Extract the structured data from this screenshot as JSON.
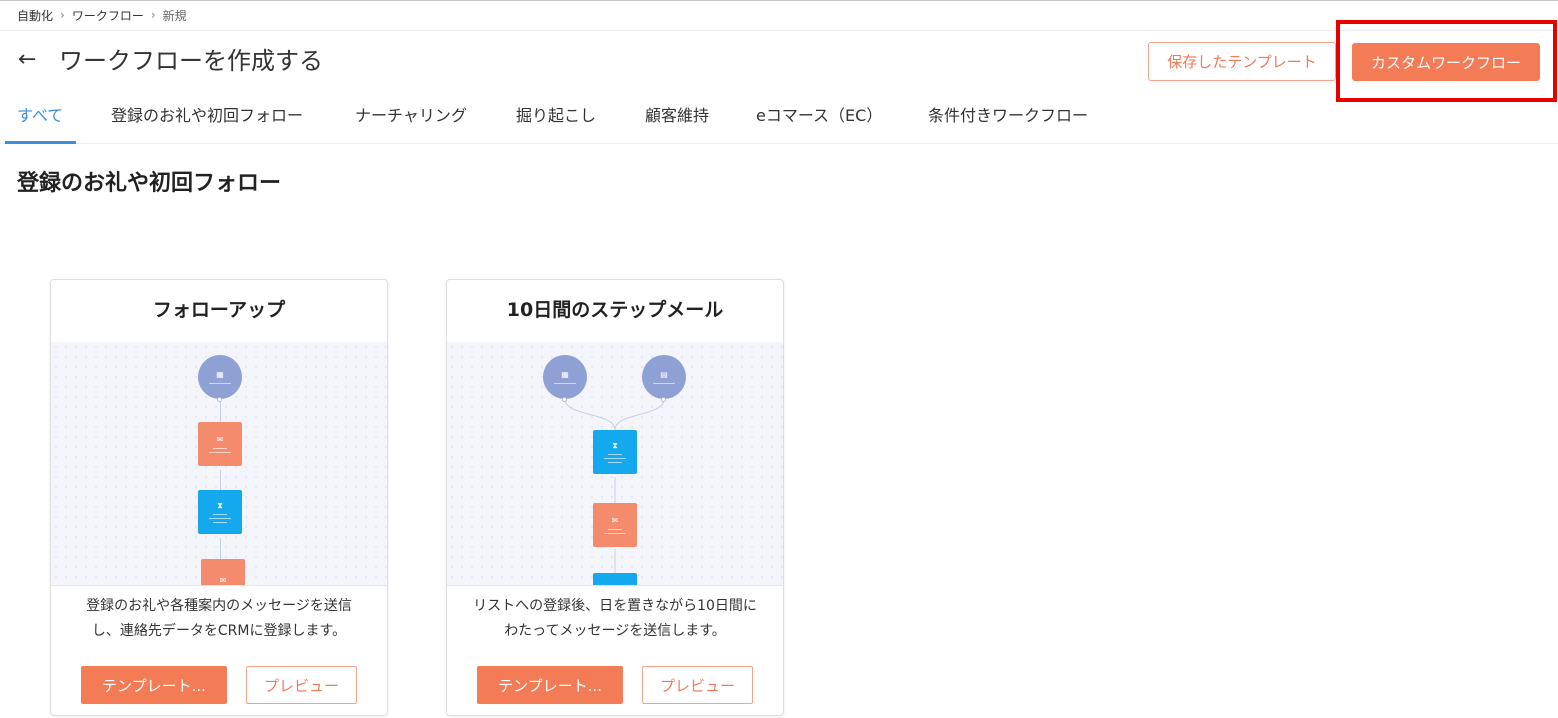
{
  "breadcrumb": {
    "items": [
      "自動化",
      "ワークフロー",
      "新規"
    ],
    "separator": "›"
  },
  "header": {
    "back_icon": "arrow-left-icon",
    "back_glyph": "←",
    "title": "ワークフローを作成する",
    "saved_templates_label": "保存したテンプレート",
    "custom_workflow_label": "カスタムワークフロー"
  },
  "tabs": [
    {
      "label": "すべて",
      "active": true
    },
    {
      "label": "登録のお礼や初回フォロー",
      "active": false
    },
    {
      "label": "ナーチャリング",
      "active": false
    },
    {
      "label": "掘り起こし",
      "active": false
    },
    {
      "label": "顧客維持",
      "active": false
    },
    {
      "label": "eコマース（EC）",
      "active": false
    },
    {
      "label": "条件付きワークフロー",
      "active": false
    }
  ],
  "section": {
    "title": "登録のお礼や初回フォロー"
  },
  "cards": [
    {
      "title": "フォローアップ",
      "description_lines": [
        "登録のお礼や各種案内のメッセージを送信",
        "し、連絡先データをCRMに登録します。"
      ],
      "template_button": "テンプレート...",
      "preview_button": "プレビュー"
    },
    {
      "title": "10日間のステップメール",
      "description_lines": [
        "リストへの登録後、日を置きながら10日間に",
        "わたってメッセージを送信します。"
      ],
      "template_button": "テンプレート...",
      "preview_button": "プレビュー"
    }
  ],
  "colors": {
    "accent": "#f37b56",
    "active_tab": "#3d8ed8",
    "highlight": "#e60000",
    "node_trigger": "#8ea0d4",
    "node_message": "#f48b6c",
    "node_wait": "#14a8ef"
  }
}
